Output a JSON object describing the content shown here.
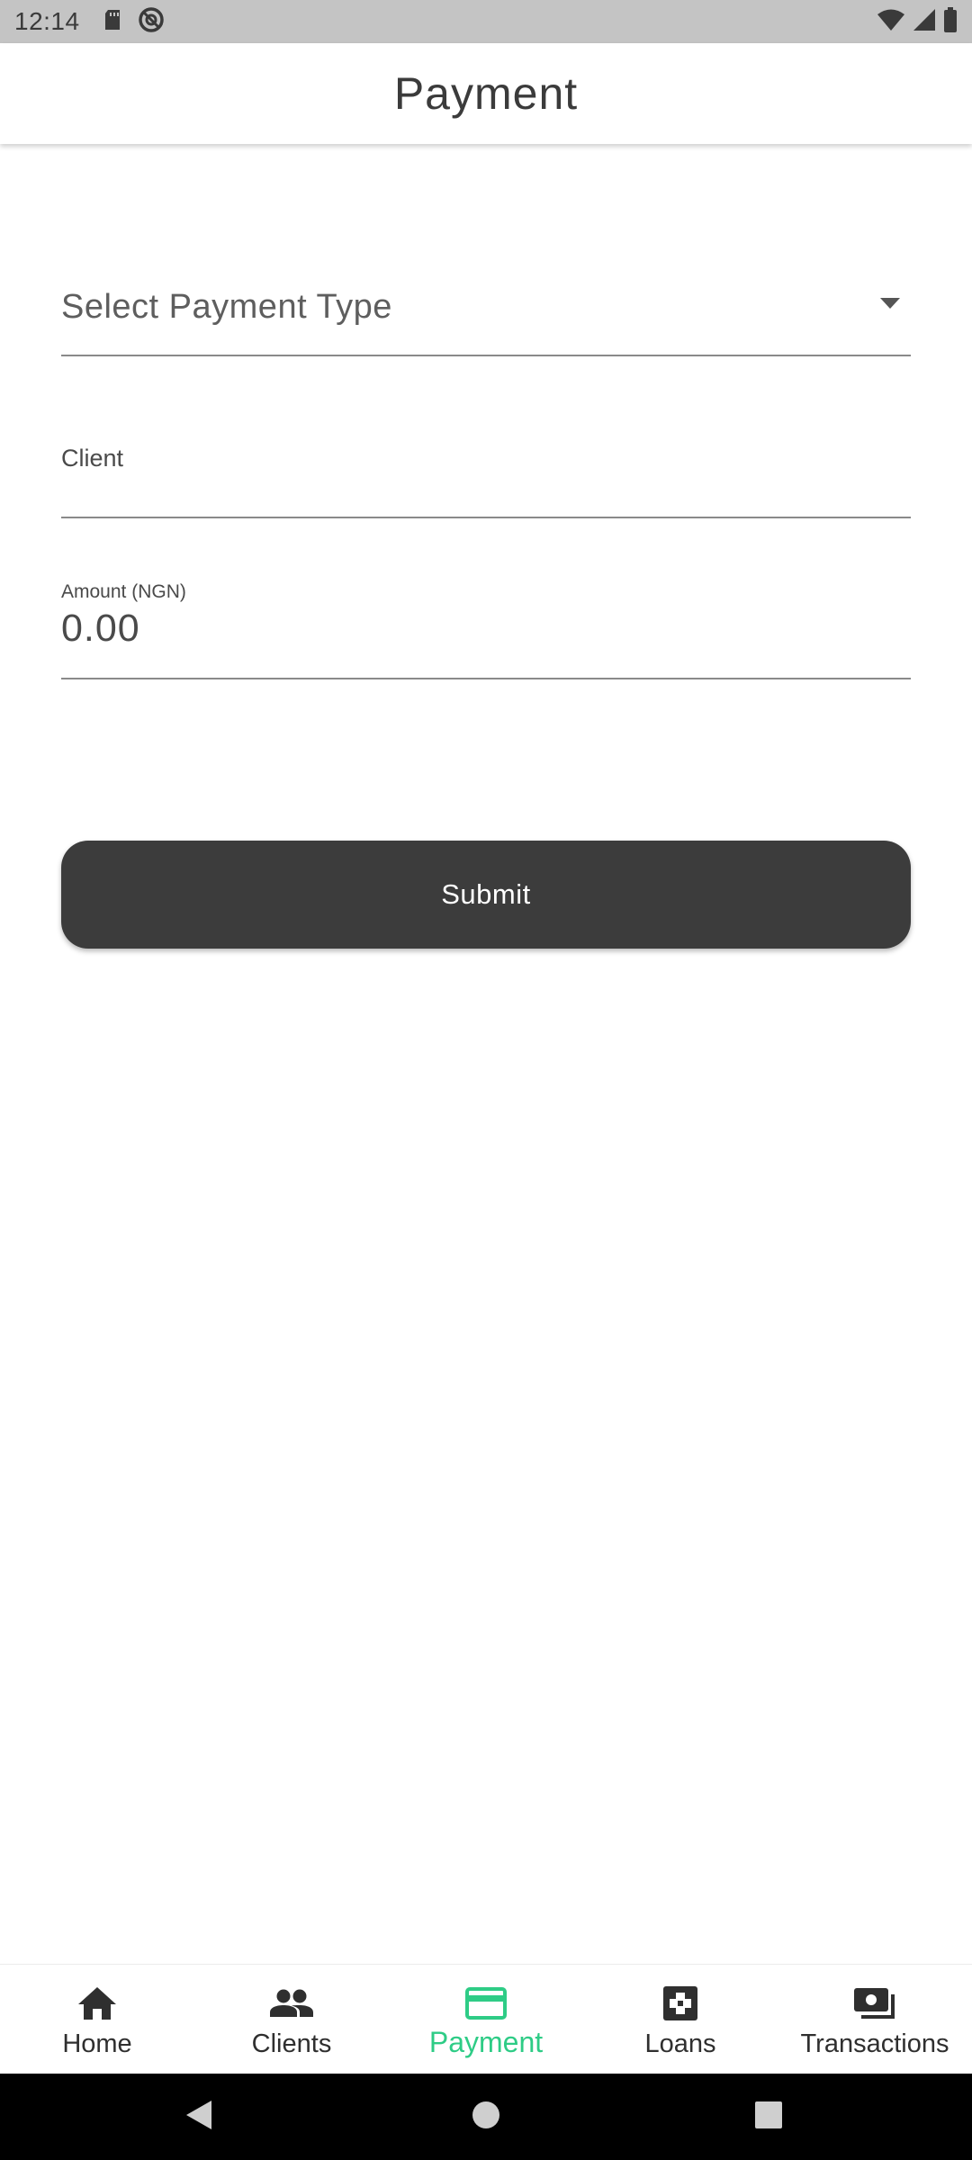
{
  "status_bar": {
    "time": "12:14",
    "left_icons": [
      "sd-card-icon",
      "do-not-disturb-icon"
    ],
    "right_icons": [
      "wifi-icon",
      "cellular-signal-icon",
      "battery-icon"
    ]
  },
  "app_bar": {
    "title": "Payment"
  },
  "form": {
    "payment_type": {
      "value": "Select Payment Type",
      "icon": "dropdown-arrow-icon"
    },
    "client": {
      "label": "Client",
      "value": ""
    },
    "amount": {
      "label": "Amount (NGN)",
      "value": "0.00"
    },
    "submit_label": "Submit"
  },
  "bottom_nav": {
    "active_color": "#2ecc86",
    "inactive_color": "#2f2f2f",
    "items": [
      {
        "label": "Home",
        "icon": "home-icon",
        "active": false
      },
      {
        "label": "Clients",
        "icon": "people-icon",
        "active": false
      },
      {
        "label": "Payment",
        "icon": "credit-card-icon",
        "active": true
      },
      {
        "label": "Loans",
        "icon": "loans-icon",
        "active": false
      },
      {
        "label": "Transactions",
        "icon": "cash-icon",
        "active": false
      }
    ]
  },
  "system_nav": [
    "back-icon",
    "home-circle-icon",
    "recents-icon"
  ]
}
